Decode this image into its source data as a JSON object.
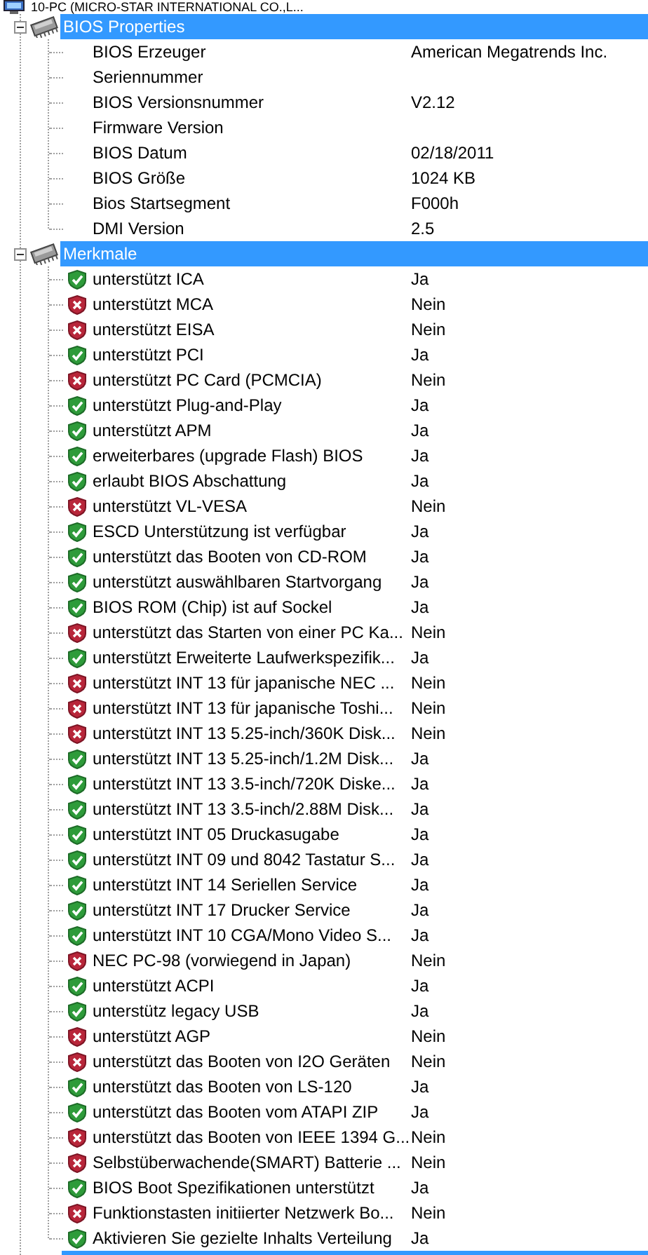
{
  "root": {
    "label": "10-PC (MICRO-STAR INTERNATIONAL CO.,L..."
  },
  "groups": [
    {
      "title": "BIOS Properties",
      "expanded": true,
      "selected": true,
      "kind": "plain",
      "items": [
        {
          "label": "BIOS Erzeuger",
          "value": "American Megatrends Inc."
        },
        {
          "label": "Seriennummer"
        },
        {
          "label": "BIOS Versionsnummer",
          "value": "V2.12"
        },
        {
          "label": "Firmware Version"
        },
        {
          "label": "BIOS Datum",
          "value": "02/18/2011"
        },
        {
          "label": "BIOS Größe",
          "value": "1024 KB"
        },
        {
          "label": "Bios Startsegment",
          "value": "F000h"
        },
        {
          "label": "DMI Version",
          "value": "2.5"
        }
      ]
    },
    {
      "title": "Merkmale",
      "expanded": true,
      "selected": true,
      "kind": "status",
      "items": [
        {
          "label": "unterstützt ICA",
          "value": "Ja",
          "ok": true
        },
        {
          "label": "unterstützt MCA",
          "value": "Nein",
          "ok": false
        },
        {
          "label": "unterstützt EISA",
          "value": "Nein",
          "ok": false
        },
        {
          "label": "unterstützt PCI",
          "value": "Ja",
          "ok": true
        },
        {
          "label": "unterstützt PC Card (PCMCIA)",
          "value": "Nein",
          "ok": false
        },
        {
          "label": "unterstützt Plug-and-Play",
          "value": "Ja",
          "ok": true
        },
        {
          "label": "unterstützt APM",
          "value": "Ja",
          "ok": true
        },
        {
          "label": "erweiterbares (upgrade Flash) BIOS",
          "value": "Ja",
          "ok": true
        },
        {
          "label": "erlaubt BIOS Abschattung",
          "value": "Ja",
          "ok": true
        },
        {
          "label": "unterstützt VL-VESA",
          "value": "Nein",
          "ok": false
        },
        {
          "label": "ESCD Unterstützung ist verfügbar",
          "value": "Ja",
          "ok": true
        },
        {
          "label": "unterstützt das Booten von CD-ROM",
          "value": "Ja",
          "ok": true
        },
        {
          "label": "unterstützt auswählbaren Startvorgang",
          "value": "Ja",
          "ok": true
        },
        {
          "label": "BIOS ROM (Chip) ist auf Sockel",
          "value": "Ja",
          "ok": true
        },
        {
          "label": "unterstützt das Starten von einer PC Ka...",
          "value": "Nein",
          "ok": false
        },
        {
          "label": "unterstützt Erweiterte Laufwerkspezifik...",
          "value": "Ja",
          "ok": true
        },
        {
          "label": "unterstützt INT 13 für japanische NEC ...",
          "value": "Nein",
          "ok": false
        },
        {
          "label": "unterstützt INT 13 für japanische Toshi...",
          "value": "Nein",
          "ok": false
        },
        {
          "label": "unterstützt INT 13 5.25-inch/360K Disk...",
          "value": "Nein",
          "ok": false
        },
        {
          "label": "unterstützt INT 13 5.25-inch/1.2M Disk...",
          "value": "Ja",
          "ok": true
        },
        {
          "label": "unterstützt INT 13 3.5-inch/720K Diske...",
          "value": "Ja",
          "ok": true
        },
        {
          "label": "unterstützt INT 13 3.5-inch/2.88M Disk...",
          "value": "Ja",
          "ok": true
        },
        {
          "label": "unterstützt INT 05 Druckasugabe",
          "value": "Ja",
          "ok": true
        },
        {
          "label": "unterstützt INT 09 und 8042 Tastatur S...",
          "value": "Ja",
          "ok": true
        },
        {
          "label": "unterstützt INT 14 Seriellen Service",
          "value": "Ja",
          "ok": true
        },
        {
          "label": "unterstützt INT 17 Drucker Service",
          "value": "Ja",
          "ok": true
        },
        {
          "label": "unterstützt INT 10 CGA/Mono Video S...",
          "value": "Ja",
          "ok": true
        },
        {
          "label": "NEC PC-98 (vorwiegend in Japan)",
          "value": "Nein",
          "ok": false
        },
        {
          "label": "unterstützt ACPI",
          "value": "Ja",
          "ok": true
        },
        {
          "label": "unterstütz legacy USB",
          "value": "Ja",
          "ok": true
        },
        {
          "label": "unterstützt AGP",
          "value": "Nein",
          "ok": false
        },
        {
          "label": "unterstützt das Booten von I2O Geräten",
          "value": "Nein",
          "ok": false
        },
        {
          "label": "unterstützt das Booten von LS-120",
          "value": "Ja",
          "ok": true
        },
        {
          "label": "unterstützt das Booten vom ATAPI ZIP",
          "value": "Ja",
          "ok": true
        },
        {
          "label": "unterstützt das Booten von IEEE 1394 G...",
          "value": "Nein",
          "ok": false
        },
        {
          "label": "Selbstüberwachende(SMART) Batterie ...",
          "value": "Nein",
          "ok": false
        },
        {
          "label": "BIOS Boot Spezifikationen unterstützt",
          "value": "Ja",
          "ok": true
        },
        {
          "label": "Funktionstasten initiierter Netzwerk Bo...",
          "value": "Nein",
          "ok": false
        },
        {
          "label": "Aktivieren Sie gezielte Inhalts Verteilung",
          "value": "Ja",
          "ok": true
        }
      ]
    }
  ]
}
